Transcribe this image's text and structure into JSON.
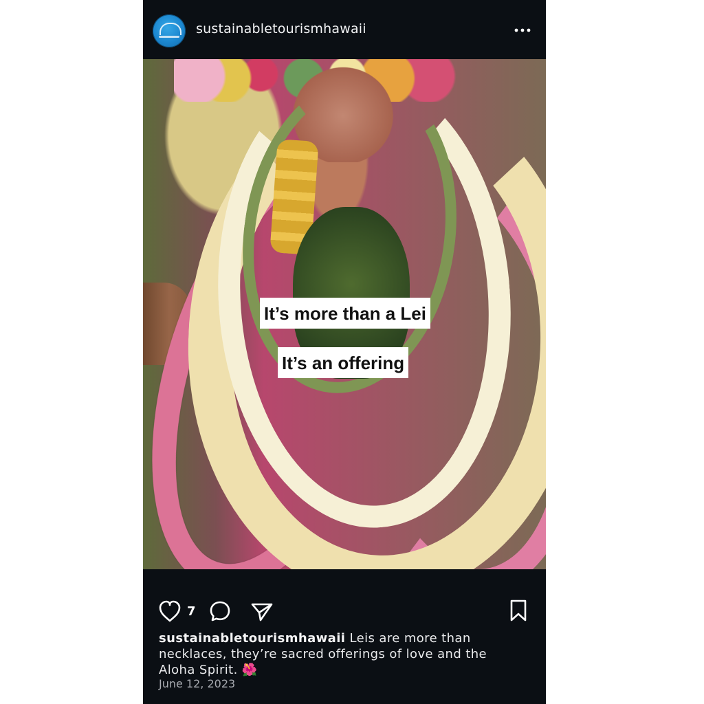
{
  "header": {
    "username": "sustainabletourismhawaii"
  },
  "post": {
    "overlay_text": {
      "line1": "It’s more than a Lei",
      "line2": "It’s an offering"
    },
    "likes_count": "7",
    "caption_username": "sustainabletourismhawaii",
    "caption_text": "Leis are more than necklaces, they’re sacred offerings of love and the Aloha Spirit. 🌺",
    "date": "June 12, 2023"
  },
  "icons": {
    "avatar": "profile-avatar",
    "more": "more-horizontal-icon",
    "like": "heart-icon",
    "comment": "comment-icon",
    "share": "send-icon",
    "save": "bookmark-icon"
  }
}
